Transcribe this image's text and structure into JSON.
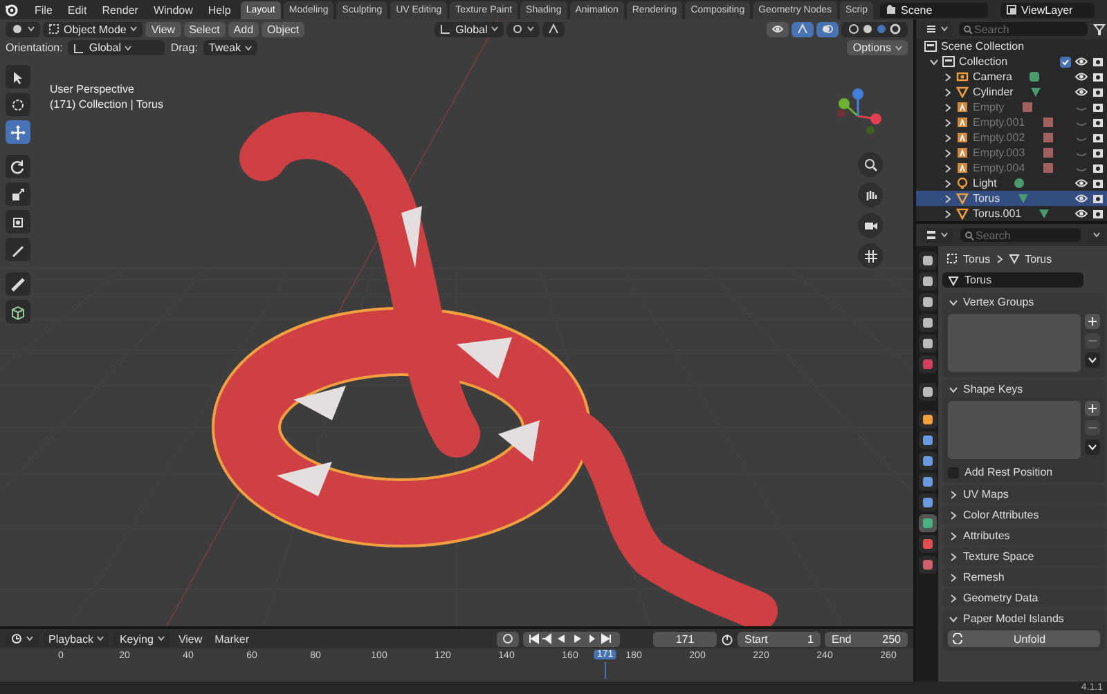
{
  "menu": [
    "File",
    "Edit",
    "Render",
    "Window",
    "Help"
  ],
  "workspace_tabs": [
    {
      "label": "Layout",
      "selected": true
    },
    {
      "label": "Modeling",
      "selected": false
    },
    {
      "label": "Sculpting",
      "selected": false
    },
    {
      "label": "UV Editing",
      "selected": false
    },
    {
      "label": "Texture Paint",
      "selected": false
    },
    {
      "label": "Shading",
      "selected": false
    },
    {
      "label": "Animation",
      "selected": false
    },
    {
      "label": "Rendering",
      "selected": false
    },
    {
      "label": "Compositing",
      "selected": false
    },
    {
      "label": "Geometry Nodes",
      "selected": false
    },
    {
      "label": "Scrip",
      "selected": false
    }
  ],
  "scene": "Scene",
  "view_layer": "ViewLayer",
  "viewport": {
    "mode": "Object Mode",
    "menus": [
      "View",
      "Select",
      "Add",
      "Object"
    ],
    "transform_orientation": "Global",
    "orientation_label": "Orientation:",
    "orientation_value": "Global",
    "drag_label": "Drag:",
    "drag_value": "Tweak",
    "options": "Options",
    "toggles": [
      {
        "kind": "visibility",
        "on": false
      },
      {
        "kind": "gizmo",
        "on": true
      },
      {
        "kind": "overlay",
        "on": true
      }
    ],
    "view_name": "User Perspective",
    "collection_info": "(171) Collection | Torus",
    "tools": [
      {
        "kind": "select",
        "selected": false
      },
      {
        "kind": "cursor",
        "selected": false
      },
      {
        "kind": "move",
        "selected": true
      },
      {
        "kind": "rotate",
        "selected": false
      },
      {
        "kind": "scale",
        "selected": false
      },
      {
        "kind": "transform",
        "selected": false
      },
      {
        "kind": "annotate",
        "selected": false
      },
      {
        "kind": "measure",
        "selected": false
      },
      {
        "kind": "add",
        "selected": false
      }
    ]
  },
  "outliner": {
    "search_placeholder": "Search",
    "scene_collection": "Scene Collection",
    "collection": {
      "name": "Collection",
      "checked": true,
      "expanded": true
    },
    "items": [
      {
        "name": "Camera",
        "kind": "camera",
        "hidden": false,
        "selected": false
      },
      {
        "name": "Cylinder",
        "kind": "mesh",
        "hidden": false,
        "selected": false
      },
      {
        "name": "Empty",
        "kind": "empty",
        "hidden": true,
        "selected": false
      },
      {
        "name": "Empty.001",
        "kind": "empty",
        "hidden": true,
        "selected": false
      },
      {
        "name": "Empty.002",
        "kind": "empty",
        "hidden": true,
        "selected": false
      },
      {
        "name": "Empty.003",
        "kind": "empty",
        "hidden": true,
        "selected": false
      },
      {
        "name": "Empty.004",
        "kind": "empty",
        "hidden": true,
        "selected": false
      },
      {
        "name": "Light",
        "kind": "light",
        "hidden": false,
        "selected": false
      },
      {
        "name": "Torus",
        "kind": "mesh",
        "hidden": false,
        "selected": true
      },
      {
        "name": "Torus.001",
        "kind": "mesh",
        "hidden": false,
        "selected": false
      }
    ]
  },
  "properties": {
    "search_placeholder": "Search",
    "breadcrumb_object": "Torus",
    "breadcrumb_data": "Torus",
    "data_name": "Torus",
    "tabs": [
      {
        "kind": "tool",
        "selected": false
      },
      {
        "kind": "render",
        "selected": false
      },
      {
        "kind": "output",
        "selected": false
      },
      {
        "kind": "view",
        "selected": false
      },
      {
        "kind": "scene",
        "selected": false
      },
      {
        "kind": "world",
        "selected": false
      },
      {
        "kind": "collection",
        "selected": false
      },
      {
        "kind": "object",
        "selected": false
      },
      {
        "kind": "modifiers",
        "selected": false
      },
      {
        "kind": "particles",
        "selected": false
      },
      {
        "kind": "physics",
        "selected": false
      },
      {
        "kind": "constraints",
        "selected": false
      },
      {
        "kind": "data",
        "selected": true
      },
      {
        "kind": "material",
        "selected": false
      },
      {
        "kind": "texture",
        "selected": false
      }
    ],
    "panels": [
      {
        "title": "Vertex Groups",
        "expanded": true,
        "kind": "list"
      },
      {
        "title": "Shape Keys",
        "expanded": true,
        "kind": "list",
        "checkbox": {
          "label": "Add Rest Position",
          "checked": false
        }
      },
      {
        "title": "UV Maps",
        "expanded": false,
        "kind": "plain"
      },
      {
        "title": "Color Attributes",
        "expanded": false,
        "kind": "plain"
      },
      {
        "title": "Attributes",
        "expanded": false,
        "kind": "plain"
      },
      {
        "title": "Texture Space",
        "expanded": false,
        "kind": "plain"
      },
      {
        "title": "Remesh",
        "expanded": false,
        "kind": "plain"
      },
      {
        "title": "Geometry Data",
        "expanded": false,
        "kind": "plain"
      },
      {
        "title": "Paper Model Islands",
        "expanded": true,
        "kind": "button",
        "button": "Unfold"
      }
    ]
  },
  "timeline": {
    "menus": [
      "Playback",
      "Keying"
    ],
    "plain_menus": [
      "View",
      "Marker"
    ],
    "current_frame": "171",
    "start_label": "Start",
    "start": "1",
    "end_label": "End",
    "end": "250",
    "ruler": [
      "0",
      "20",
      "40",
      "60",
      "80",
      "100",
      "120",
      "140",
      "160",
      "180",
      "200",
      "220",
      "240",
      "260"
    ],
    "playhead": "171"
  },
  "status_version": "4.1.1"
}
